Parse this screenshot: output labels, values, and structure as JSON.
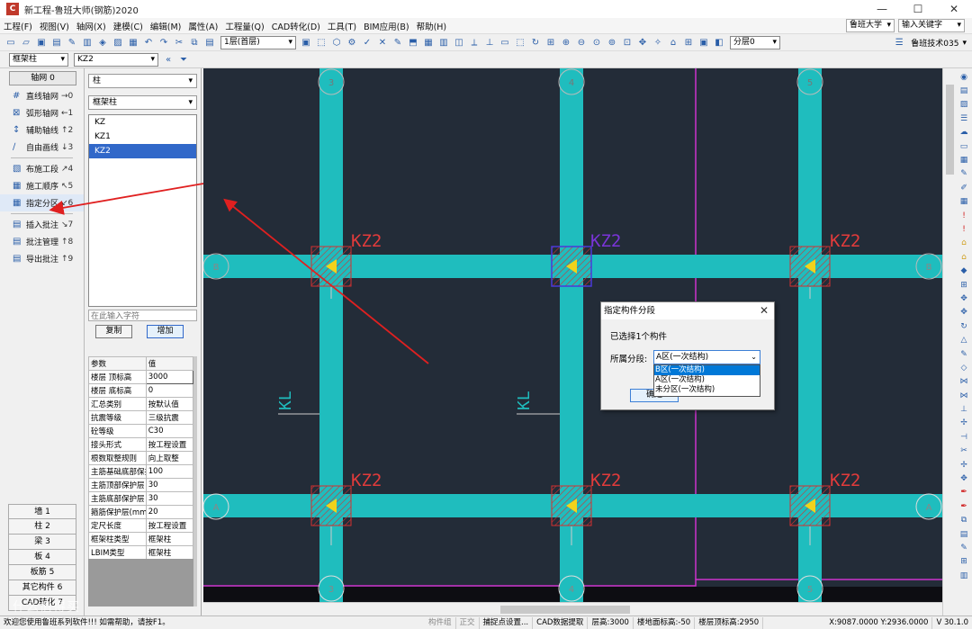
{
  "titlebar": {
    "logo": "C",
    "title": "新工程-鲁班大师(钢筋)2020",
    "min": "—",
    "max": "☐",
    "close": "✕"
  },
  "menu": [
    "工程(F)",
    "视图(V)",
    "轴网(X)",
    "建模(C)",
    "编辑(M)",
    "属性(A)",
    "工程量(Q)",
    "CAD转化(D)",
    "工具(T)",
    "BIM应用(B)",
    "帮助(H)"
  ],
  "menu_right": {
    "org": "鲁班大学",
    "search_placeholder": "输入关键字"
  },
  "toolbar": {
    "floor": "1层(首层)",
    "division": "分层0",
    "version_label": "鲁班技术035"
  },
  "toolbar2": {
    "type": "框架柱",
    "name": "KZ2"
  },
  "left": {
    "grid_header": "轴网 0",
    "tools": [
      {
        "icon": "#",
        "label": "直线轴网",
        "sc": "→0"
      },
      {
        "icon": "⊠",
        "label": "弧形轴网",
        "sc": "←1"
      },
      {
        "icon": "↕",
        "label": "辅助轴线",
        "sc": "↑2"
      },
      {
        "icon": "∕",
        "label": "自由画线",
        "sc": "↓3"
      },
      {
        "icon": "▧",
        "label": "布施工段",
        "sc": "↗4"
      },
      {
        "icon": "▦",
        "label": "施工顺序",
        "sc": "↖5"
      },
      {
        "icon": "▦",
        "label": "指定分区",
        "sc": "↙6"
      },
      {
        "icon": "▤",
        "label": "插入批注",
        "sc": "↘7"
      },
      {
        "icon": "▤",
        "label": "批注管理",
        "sc": "↑8"
      },
      {
        "icon": "▤",
        "label": "导出批注",
        "sc": "↑9"
      }
    ],
    "cats": [
      "墙 1",
      "柱 2",
      "梁 3",
      "板 4",
      "板筋 5",
      "其它构件 6",
      "CAD转化 7"
    ]
  },
  "mid": {
    "type1": "柱",
    "type2": "框架柱",
    "list": [
      "KZ",
      "KZ1",
      "KZ2"
    ],
    "filter_placeholder": "在此输入字符",
    "copy": "复制",
    "add": "增加",
    "prop_head": [
      "参数",
      "值"
    ],
    "props": [
      [
        "楼层 顶标高",
        "3000"
      ],
      [
        "楼层 底标高",
        "0"
      ],
      [
        "汇总类别",
        "按默认值"
      ],
      [
        "抗震等级",
        "三级抗震"
      ],
      [
        "砼等级",
        "C30"
      ],
      [
        "接头形式",
        "按工程设置"
      ],
      [
        "根数取整规则",
        "向上取整"
      ],
      [
        "主筋基础底部保护层",
        "100"
      ],
      [
        "主筋顶部保护层",
        "30"
      ],
      [
        "主筋底部保护层",
        "30"
      ],
      [
        "箍筋保护层(mm)",
        "20"
      ],
      [
        "定尺长度",
        "按工程设置"
      ],
      [
        "框架柱类型",
        "框架柱"
      ],
      [
        "LBIM类型",
        "框架柱"
      ]
    ]
  },
  "canvas": {
    "col_labels": [
      "KZ2",
      "KZ2",
      "KZ2",
      "KZ2",
      "KZ2",
      "KZ2"
    ],
    "beam_labels": [
      "KL",
      "KL"
    ],
    "axis_top": [
      "3",
      "4",
      "5"
    ],
    "axis_bottom": [
      "3",
      "4",
      "5"
    ],
    "axis_side": [
      "B",
      "B",
      "A",
      "A"
    ]
  },
  "dialog": {
    "title": "指定构件分段",
    "info": "已选择1个构件",
    "label": "所属分段:",
    "value": "A区(一次结构)",
    "options": [
      "B区(一次结构)",
      "A区(一次结构)",
      "未分区(一次结构)"
    ],
    "ok": "确定",
    "default_btn": "设为默认",
    "close": "✕"
  },
  "status": {
    "welcome": "欢迎您使用鲁班系列软件!!!  如需帮助，请按F1。",
    "s1": "构件组",
    "s2": "正交",
    "s3": "捕捉点设置...",
    "s4": "CAD数据提取",
    "s5": "层高:3000",
    "s6": "楼地面标高:-50",
    "s7": "楼层顶标高:2950",
    "coords": "X:9087.0000 Y:2936.0000",
    "ver": "V 30.1.0"
  },
  "watermark": "什么值得买",
  "colors": {
    "canvas": "#232c38",
    "beam": "#1fbdbe",
    "label": "#e23b3b",
    "label_sel": "#7a34d8",
    "magenta": "#cc33cc",
    "arrow": "#e02020",
    "col_yellow": "#f2d21b"
  }
}
